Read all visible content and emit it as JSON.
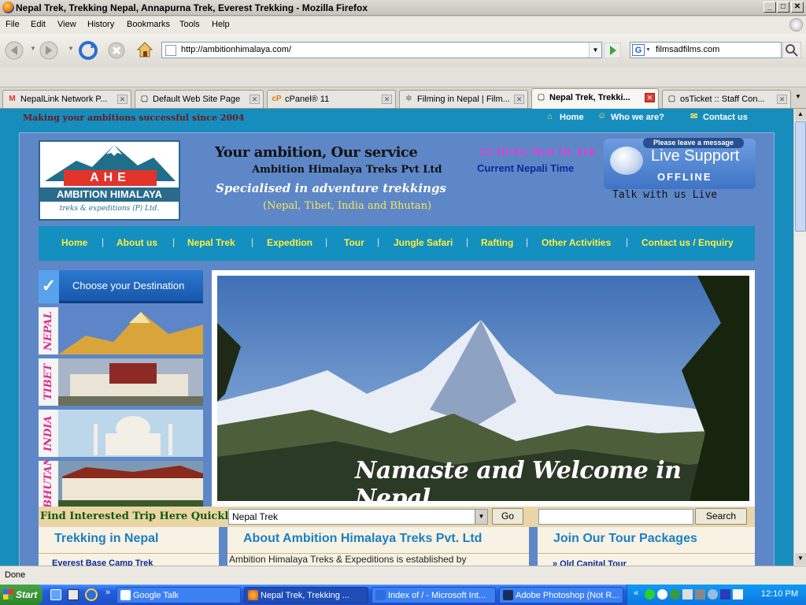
{
  "window": {
    "title": "Nepal Trek, Trekking Nepal, Annapurna Trek, Everest Trekking - Mozilla Firefox",
    "controls": {
      "minimize": "_",
      "maximize": "□",
      "close": "✕"
    }
  },
  "menu": [
    "File",
    "Edit",
    "View",
    "History",
    "Bookmarks",
    "Tools",
    "Help"
  ],
  "nav": {
    "url": "http://ambitionhimalaya.com/",
    "search_value": "filmsadfilms.com",
    "search_engine_icon": "G"
  },
  "tabs": [
    {
      "label": "NepalLink Network P...",
      "icon": "M",
      "active": false
    },
    {
      "label": "Default Web Site Page",
      "icon": "▢",
      "active": false
    },
    {
      "label": "cPanel® 11",
      "icon": "cP",
      "active": false
    },
    {
      "label": "Filming in Nepal | Film...",
      "icon": "✲",
      "active": false
    },
    {
      "label": "Nepal Trek, Trekki...",
      "icon": "▢",
      "active": true
    },
    {
      "label": "osTicket :: Staff Con...",
      "icon": "▢",
      "active": false
    }
  ],
  "page": {
    "strip_text": "Making your ambitions successful since 2004",
    "toplinks": [
      "Home",
      "Who we are?",
      "Contact us"
    ],
    "logo": {
      "acronym": "AHE",
      "name": "AMBITION HIMALAYA",
      "sub": "treks & expeditions (P) Ltd."
    },
    "tagline": {
      "line1": "Your ambition, Our service",
      "line2": "Ambition Himalaya Treks Pvt Ltd",
      "line3": "Specialised in adventure trekkings",
      "line4": "(Nepal, Tibet, India and Bhutan)"
    },
    "clock": {
      "time": "12:10:44, Wed 10, Feb",
      "label": "Current Nepali Time"
    },
    "live_support": {
      "top": "Please leave a message",
      "title": "Live Support",
      "status": "OFFLINE",
      "talk": "Talk with us Live"
    },
    "mainnav": [
      "Home",
      "About us",
      "Nepal Trek",
      "Expedtion",
      "Tour",
      "Jungle Safari",
      "Rafting",
      "Other Activities",
      "Contact us / Enquiry"
    ],
    "choose": "Choose your Destination",
    "destinations": [
      "NEPAL",
      "TIBET",
      "INDIA",
      "BHUTAN"
    ],
    "welcome": "Namaste and Welcome in Nepal",
    "find": {
      "label": "Find Interested Trip Here Quickly:",
      "selected": "Nepal Trek",
      "go": "Go",
      "search_btn": "Search"
    },
    "columns": [
      {
        "head": "Trekking in Nepal",
        "item": "Everest Base Camp Trek"
      },
      {
        "head": "About Ambition Himalaya Treks Pvt. Ltd",
        "item": "Ambition Himalaya Treks & Expeditions is established by"
      },
      {
        "head": "Join Our Tour Packages",
        "item": "» Old Capital Tour"
      }
    ]
  },
  "status": "Done",
  "taskbar": {
    "start": "Start",
    "items": [
      {
        "label": "Google Talk",
        "active": false
      },
      {
        "label": "Nepal Trek, Trekking ...",
        "active": true
      },
      {
        "label": "Index of / - Microsoft Int...",
        "active": false
      },
      {
        "label": "Adobe Photoshop (Not R...",
        "active": false
      }
    ],
    "clock": "12:10 PM"
  }
}
